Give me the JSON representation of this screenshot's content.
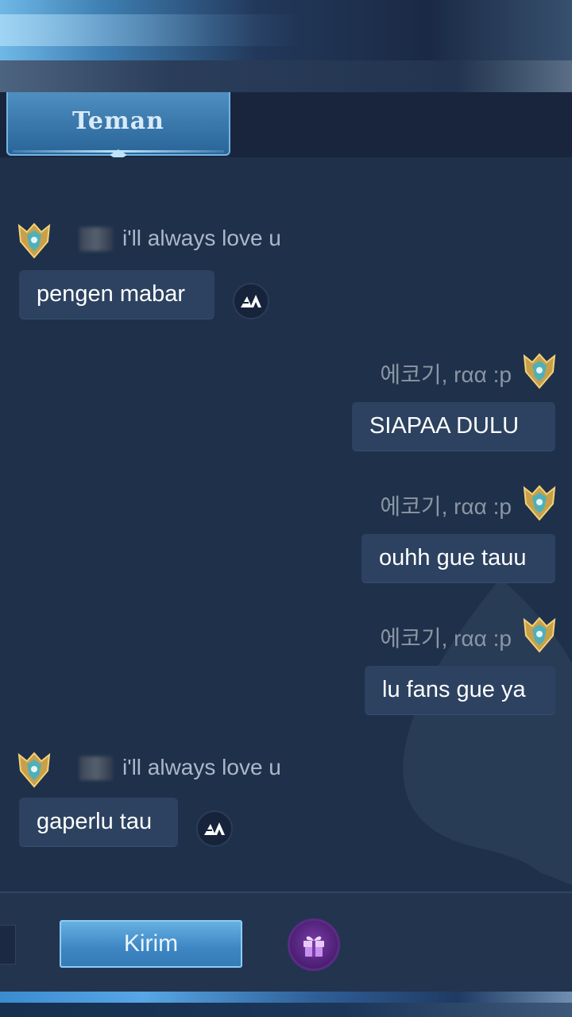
{
  "tabs": [
    {
      "label": "Teman",
      "active": true
    }
  ],
  "messages": [
    {
      "direction": "incoming",
      "sender": "i'll always love u",
      "text": "pengen mabar",
      "translate": true
    },
    {
      "direction": "outgoing",
      "sender": "에코기, rαα :p",
      "text": "SIAPAA DULU"
    },
    {
      "direction": "outgoing",
      "sender": "에코기, rαα :p",
      "text": "ouhh gue tauu"
    },
    {
      "direction": "outgoing",
      "sender": "에코기, rαα :p",
      "text": "lu fans gue ya"
    },
    {
      "direction": "incoming",
      "sender": "i'll always love u",
      "text": "gaperlu tau",
      "translate": true
    }
  ],
  "composer": {
    "send_label": "Kirim"
  },
  "icons": {
    "avatar": "rank-badge-icon",
    "translate": "translate-icon",
    "gift": "gift-icon"
  },
  "colors": {
    "background": "#1f304a",
    "bubble": "#2c4260",
    "accent": "#3d86c3"
  }
}
